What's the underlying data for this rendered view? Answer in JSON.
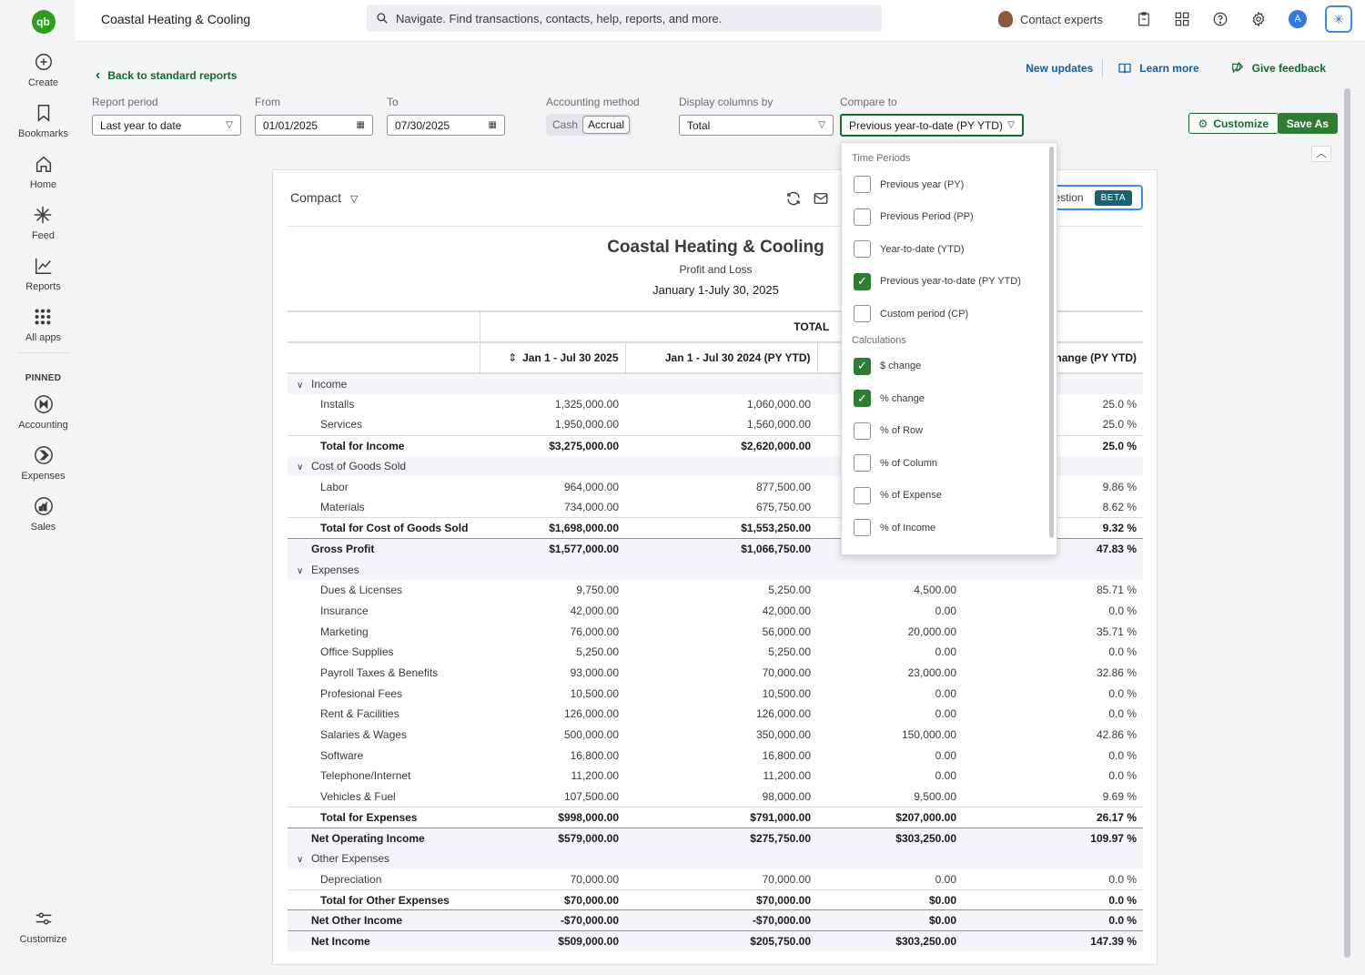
{
  "app": {
    "logo": "qb",
    "company": "Coastal Heating & Cooling"
  },
  "search": {
    "placeholder": "Navigate. Find transactions, contacts, help, reports, and more."
  },
  "topbar": {
    "contact_label": "Contact experts",
    "user_initial": "A"
  },
  "sidebar": {
    "items": [
      {
        "label": "Create",
        "icon": "plus-circle-icon"
      },
      {
        "label": "Bookmarks",
        "icon": "bookmark-icon"
      },
      {
        "label": "Home",
        "icon": "home-icon"
      },
      {
        "label": "Feed",
        "icon": "sparkle-icon"
      },
      {
        "label": "Reports",
        "icon": "chart-icon"
      },
      {
        "label": "All apps",
        "icon": "grid-icon"
      }
    ],
    "pinned_label": "PINNED",
    "pinned": [
      {
        "label": "Accounting",
        "icon": "accounting-icon"
      },
      {
        "label": "Expenses",
        "icon": "expenses-icon"
      },
      {
        "label": "Sales",
        "icon": "sales-icon"
      }
    ],
    "customize_label": "Customize"
  },
  "header": {
    "back_label": "Back to standard reports",
    "new_updates": "New updates",
    "learn_more": "Learn more",
    "give_feedback": "Give feedback"
  },
  "filters": {
    "report_period_label": "Report period",
    "report_period_value": "Last year to date",
    "from_label": "From",
    "from_value": "01/01/2025",
    "to_label": "To",
    "to_value": "07/30/2025",
    "accounting_method_label": "Accounting method",
    "method_cash": "Cash",
    "method_accrual": "Accrual",
    "display_columns_label": "Display columns by",
    "display_columns_value": "Total",
    "compare_label": "Compare to",
    "compare_value": "Previous year-to-date (PY YTD)",
    "customize_btn": "Customize",
    "save_as_btn": "Save As"
  },
  "report": {
    "view_label": "Compact",
    "ask_label": "estion",
    "beta_label": "BETA",
    "company": "Coastal Heating & Cooling",
    "subtitle": "Profit and Loss",
    "date_range": "January 1-July 30, 2025",
    "total_header": "TOTAL",
    "columns": [
      "Jan 1 - Jul 30 2025",
      "Jan 1 - Jul 30 2024 (PY YTD)",
      "",
      "hange (PY YTD)"
    ],
    "rows": [
      {
        "type": "section",
        "label": "Income",
        "v": [
          "",
          "",
          "",
          ""
        ]
      },
      {
        "type": "item",
        "label": "Installs",
        "v": [
          "1,325,000.00",
          "1,060,000.00",
          "",
          "25.0 %"
        ]
      },
      {
        "type": "item",
        "label": "Services",
        "v": [
          "1,950,000.00",
          "1,560,000.00",
          "",
          "25.0 %"
        ]
      },
      {
        "type": "sub",
        "label": "Total for Income",
        "v": [
          "$3,275,000.00",
          "$2,620,000.00",
          "",
          "25.0 %"
        ]
      },
      {
        "type": "section",
        "label": "Cost of Goods Sold",
        "v": [
          "",
          "",
          "",
          ""
        ]
      },
      {
        "type": "item",
        "label": "Labor",
        "v": [
          "964,000.00",
          "877,500.00",
          "",
          "9.86 %"
        ]
      },
      {
        "type": "item",
        "label": "Materials",
        "v": [
          "734,000.00",
          "675,750.00",
          "",
          "8.62 %"
        ]
      },
      {
        "type": "sub",
        "label": "Total for Cost of Goods Sold",
        "v": [
          "$1,698,000.00",
          "$1,553,250.00",
          "",
          "9.32 %"
        ]
      },
      {
        "type": "grand",
        "label": "Gross Profit",
        "v": [
          "$1,577,000.00",
          "$1,066,750.00",
          "",
          "47.83 %"
        ]
      },
      {
        "type": "section",
        "label": "Expenses",
        "v": [
          "",
          "",
          "",
          ""
        ]
      },
      {
        "type": "item",
        "label": "Dues & Licenses",
        "v": [
          "9,750.00",
          "5,250.00",
          "4,500.00",
          "85.71 %"
        ]
      },
      {
        "type": "item",
        "label": "Insurance",
        "v": [
          "42,000.00",
          "42,000.00",
          "0.00",
          "0.0 %"
        ]
      },
      {
        "type": "item",
        "label": "Marketing",
        "v": [
          "76,000.00",
          "56,000.00",
          "20,000.00",
          "35.71 %"
        ]
      },
      {
        "type": "item",
        "label": "Office Supplies",
        "v": [
          "5,250.00",
          "5,250.00",
          "0.00",
          "0.0 %"
        ]
      },
      {
        "type": "item",
        "label": "Payroll Taxes & Benefits",
        "v": [
          "93,000.00",
          "70,000.00",
          "23,000.00",
          "32.86 %"
        ]
      },
      {
        "type": "item",
        "label": "Profesional Fees",
        "v": [
          "10,500.00",
          "10,500.00",
          "0.00",
          "0.0 %"
        ]
      },
      {
        "type": "item",
        "label": "Rent & Facilities",
        "v": [
          "126,000.00",
          "126,000.00",
          "0.00",
          "0.0 %"
        ]
      },
      {
        "type": "item",
        "label": "Salaries & Wages",
        "v": [
          "500,000.00",
          "350,000.00",
          "150,000.00",
          "42.86 %"
        ]
      },
      {
        "type": "item",
        "label": "Software",
        "v": [
          "16,800.00",
          "16,800.00",
          "0.00",
          "0.0 %"
        ]
      },
      {
        "type": "item",
        "label": "Telephone/Internet",
        "v": [
          "11,200.00",
          "11,200.00",
          "0.00",
          "0.0 %"
        ]
      },
      {
        "type": "item",
        "label": "Vehicles & Fuel",
        "v": [
          "107,500.00",
          "98,000.00",
          "9,500.00",
          "9.69 %"
        ]
      },
      {
        "type": "sub",
        "label": "Total for Expenses",
        "v": [
          "$998,000.00",
          "$791,000.00",
          "$207,000.00",
          "26.17 %"
        ]
      },
      {
        "type": "grand",
        "label": "Net Operating Income",
        "v": [
          "$579,000.00",
          "$275,750.00",
          "$303,250.00",
          "109.97 %"
        ]
      },
      {
        "type": "section",
        "label": "Other Expenses",
        "v": [
          "",
          "",
          "",
          ""
        ]
      },
      {
        "type": "item",
        "label": "Depreciation",
        "v": [
          "70,000.00",
          "70,000.00",
          "0.00",
          "0.0 %"
        ]
      },
      {
        "type": "sub",
        "label": "Total for Other Expenses",
        "v": [
          "$70,000.00",
          "$70,000.00",
          "$0.00",
          "0.0 %"
        ]
      },
      {
        "type": "grand",
        "label": "Net Other Income",
        "v": [
          "-$70,000.00",
          "-$70,000.00",
          "$0.00",
          "0.0 %"
        ]
      },
      {
        "type": "grand",
        "label": "Net Income",
        "v": [
          "$509,000.00",
          "$205,750.00",
          "$303,250.00",
          "147.39 %"
        ]
      }
    ]
  },
  "compare_menu": {
    "time_periods_label": "Time Periods",
    "time_periods": [
      {
        "label": "Previous year (PY)",
        "checked": false
      },
      {
        "label": "Previous Period (PP)",
        "checked": false
      },
      {
        "label": "Year-to-date (YTD)",
        "checked": false
      },
      {
        "label": "Previous year-to-date (PY YTD)",
        "checked": true
      },
      {
        "label": "Custom period (CP)",
        "checked": false
      }
    ],
    "calculations_label": "Calculations",
    "calculations": [
      {
        "label": "$ change",
        "checked": true
      },
      {
        "label": "% change",
        "checked": true
      },
      {
        "label": "% of Row",
        "checked": false
      },
      {
        "label": "% of Column",
        "checked": false
      },
      {
        "label": "% of Expense",
        "checked": false
      },
      {
        "label": "% of Income",
        "checked": false
      }
    ]
  },
  "colors": {
    "brand_green": "#2ca01c",
    "action_green": "#2e7d32",
    "link_blue": "#0d5fa6",
    "ai_blue": "#3a8df5"
  }
}
